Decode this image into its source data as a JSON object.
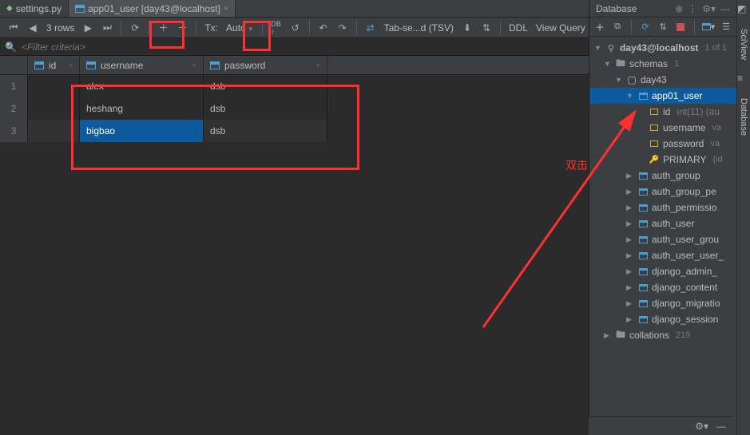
{
  "tabs": [
    {
      "label": "settings.py",
      "icon": "python"
    },
    {
      "label": "app01_user [day43@localhost]",
      "icon": "table",
      "active": true
    }
  ],
  "toolbar": {
    "rows_label": "3 rows",
    "tx_label": "Tx:",
    "tx_mode": "Auto",
    "tab_sep_label": "Tab-se...d (TSV)",
    "ddl_label": "DDL",
    "view_query_label": "View Query"
  },
  "filter_placeholder": "<Filter criteria>",
  "table": {
    "columns": [
      {
        "key": "id",
        "label": "id"
      },
      {
        "key": "username",
        "label": "username"
      },
      {
        "key": "password",
        "label": "password"
      }
    ],
    "rows": [
      {
        "n": "1",
        "id": "",
        "username": "alex",
        "password": "dsb"
      },
      {
        "n": "2",
        "id": "",
        "username": "heshang",
        "password": "dsb"
      },
      {
        "n": "3",
        "id": "",
        "username": "bigbao",
        "password": "dsb",
        "selected": true
      }
    ]
  },
  "database_panel": {
    "title": "Database",
    "connection": "day43@localhost",
    "conn_badge": "1 of 1",
    "schemas_label": "schemas",
    "schemas_count": "1",
    "schema_name": "day43",
    "tables": {
      "selected": "app01_user",
      "selected_columns": [
        {
          "name": "id",
          "type": "int(11)",
          "extra": "(au"
        },
        {
          "name": "username",
          "type": "va"
        },
        {
          "name": "password",
          "type": "va"
        }
      ],
      "selected_key": "PRIMARY",
      "selected_key_extra": "(id",
      "others": [
        "auth_group",
        "auth_group_pe",
        "auth_permissio",
        "auth_user",
        "auth_user_grou",
        "auth_user_user_",
        "django_admin_",
        "django_content",
        "django_migratio",
        "django_session"
      ]
    },
    "collations_label": "collations",
    "collations_count": "219"
  },
  "side_tabs": {
    "sciview": "SciView",
    "database": "Database"
  },
  "annotation_text": "双击"
}
